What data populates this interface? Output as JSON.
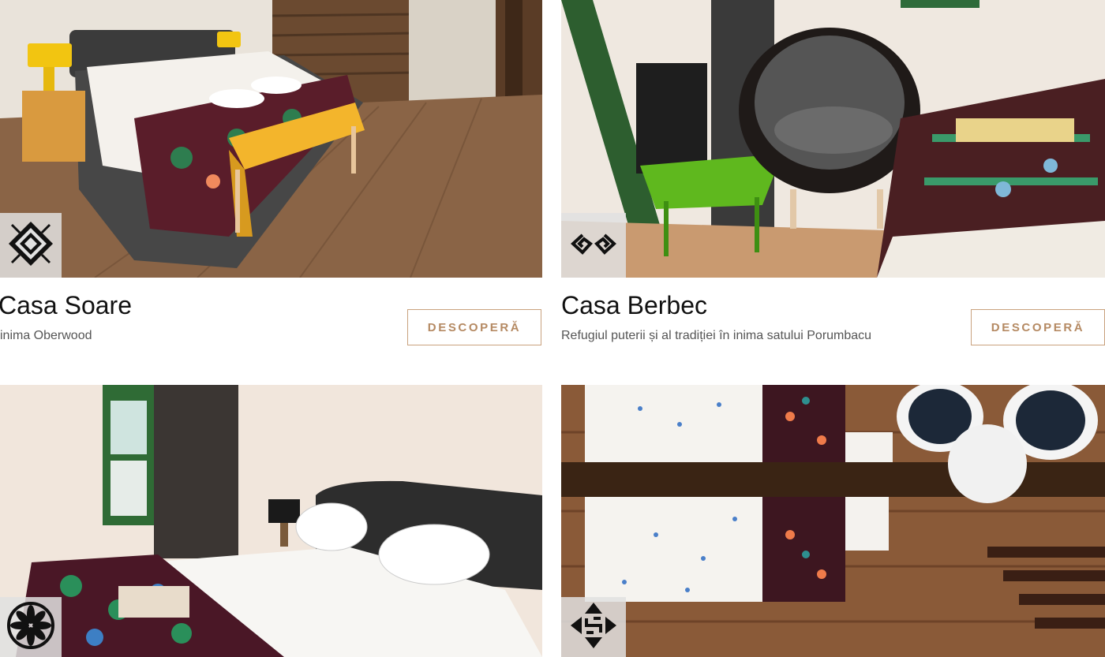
{
  "cards": [
    {
      "title": "Casa Soare",
      "subtitle": "Refugiul soarelui în inima Oberwood",
      "subtitle_visible": "inima Oberwood",
      "button_label": "DESCOPERĂ",
      "badge_icon": "sun-motif-icon",
      "photo": "bedroom-with-yellow-bench"
    },
    {
      "title": "Casa Berbec",
      "subtitle": "Refugiul puterii și al tradiției în inima satului Porumbacu",
      "button_label": "DESCOPERĂ",
      "badge_icon": "ram-horns-motif-icon",
      "photo": "room-with-armchair-and-green-table"
    },
    {
      "badge_icon": "rosette-motif-icon",
      "photo": "bedroom-with-green-window"
    },
    {
      "badge_icon": "swirl-motif-icon",
      "photo": "top-view-bedroom-with-beam"
    }
  ],
  "colors": {
    "button_border": "#c9a27e",
    "button_text": "#b58a63",
    "title": "#111111",
    "subtitle": "#555555",
    "badge_bg": "#e1e1e1"
  }
}
